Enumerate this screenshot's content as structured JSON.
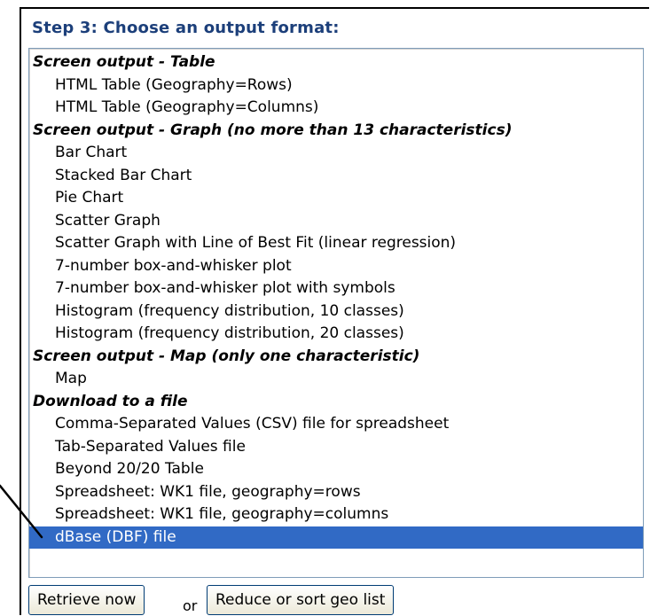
{
  "step_title": "Step 3: Choose an output format:",
  "listbox": {
    "groups": [
      {
        "label": "Screen output - Table",
        "options": [
          "HTML Table (Geography=Rows)",
          "HTML Table (Geography=Columns)"
        ]
      },
      {
        "label": "Screen output - Graph (no more than 13 characteristics)",
        "options": [
          "Bar Chart",
          "Stacked Bar Chart",
          "Pie Chart",
          "Scatter Graph",
          "Scatter Graph with Line of Best Fit (linear regression)",
          "7-number box-and-whisker plot",
          "7-number box-and-whisker plot with symbols",
          "Histogram (frequency distribution, 10 classes)",
          "Histogram (frequency distribution, 20 classes)"
        ]
      },
      {
        "label": "Screen output - Map (only one characteristic)",
        "options": [
          "Map"
        ]
      },
      {
        "label": "Download to a file",
        "options": [
          "Comma-Separated Values (CSV) file for spreadsheet",
          "Tab-Separated Values file",
          "Beyond 20/20 Table",
          "Spreadsheet: WK1 file, geography=rows",
          "Spreadsheet: WK1 file, geography=columns",
          "dBase (DBF) file"
        ]
      }
    ],
    "selected": "dBase (DBF) file",
    "selection_color": "#316ac5"
  },
  "buttons": {
    "retrieve_label": "Retrieve now",
    "or_text": "or",
    "reduce_label": "Reduce or sort geo list"
  },
  "title_color": "#1c3f7a"
}
